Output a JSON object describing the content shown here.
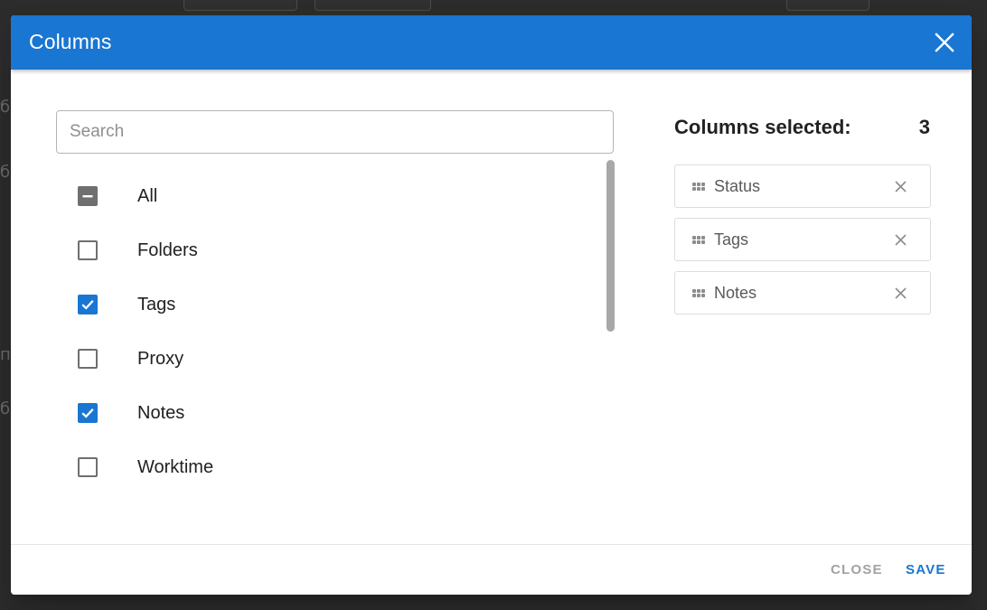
{
  "dialog": {
    "title": "Columns"
  },
  "search": {
    "placeholder": "Search",
    "value": ""
  },
  "columns": [
    {
      "label": "All",
      "state": "indeterminate"
    },
    {
      "label": "Folders",
      "state": "unchecked"
    },
    {
      "label": "Tags",
      "state": "checked"
    },
    {
      "label": "Proxy",
      "state": "unchecked"
    },
    {
      "label": "Notes",
      "state": "checked"
    },
    {
      "label": "Worktime",
      "state": "unchecked"
    }
  ],
  "selected": {
    "title": "Columns selected:",
    "count": "3",
    "items": [
      {
        "label": "Status"
      },
      {
        "label": "Tags"
      },
      {
        "label": "Notes"
      }
    ]
  },
  "footer": {
    "close_label": "CLOSE",
    "save_label": "SAVE"
  },
  "colors": {
    "primary": "#1976d2",
    "checkbox_border": "#6f6f6f",
    "disabled_text": "#a2a2a2"
  },
  "icons": {
    "close": "close-icon",
    "checkbox_checked": "check-icon",
    "checkbox_indeterminate": "minus-icon",
    "drag": "drag-handle-icon",
    "remove": "remove-icon"
  }
}
